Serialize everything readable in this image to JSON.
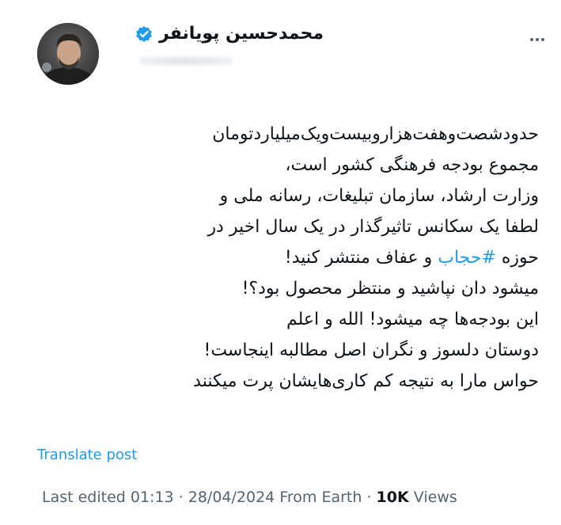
{
  "post": {
    "author_name": "محمدحسین پویانفر",
    "text_lines": [
      "حدودشصت‌وهفت‌هزاروبیست‌ویک‌میلیاردتومان",
      "مجموع بودجه فرهنگی کشور است،",
      "وزارت ارشاد، سازمان تبلیغات، رسانه ملی و",
      "لطفا یک سکانس تاثیرگذار در یک سال اخیر در",
      "میشود دان نپاشید و منتظر محصول بود؟!",
      "این بودجه‌ها چه میشود! الله و اعلم",
      "دوستان دلسوز و نگران اصل مطالبه اینجاست!",
      "حواس مارا به نتیجه کم کاری‌هایشان پرت میکنند"
    ],
    "hashtag_line": {
      "before": "حوزه ",
      "hashtag": "#حجاب",
      "after": " و عفاف منتشر کنید!"
    },
    "translate_label": "Translate post",
    "meta": {
      "edited": "Last edited 01:13 · 28/04/2024",
      "location": "From Earth",
      "separator": "·",
      "views_count": "10K",
      "views_label": "Views"
    }
  },
  "icons": {
    "verified": "verified-badge-icon",
    "more": "more-options-icon"
  },
  "colors": {
    "accent": "#1d9bf0",
    "text": "#0f1419",
    "muted": "#536471"
  }
}
